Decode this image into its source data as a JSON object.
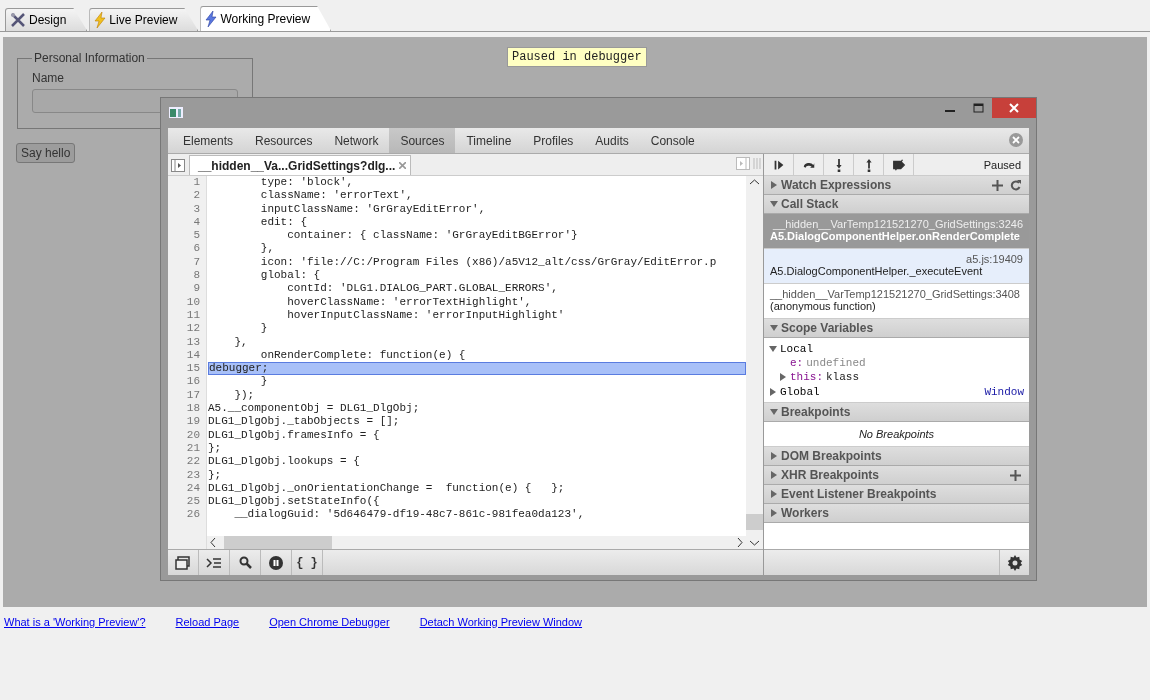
{
  "app_tabs": [
    {
      "kind": "design",
      "label": "Design",
      "selected": false
    },
    {
      "kind": "live",
      "label": "Live Preview",
      "selected": false
    },
    {
      "kind": "working",
      "label": "Working Preview",
      "selected": true
    }
  ],
  "preview": {
    "paused_label": "Paused in debugger",
    "fieldset_legend": "Personal Information",
    "name_label": "Name",
    "button": "Say hello"
  },
  "devtools": {
    "tabs": [
      {
        "label": "Elements",
        "selected": false
      },
      {
        "label": "Resources",
        "selected": false
      },
      {
        "label": "Network",
        "selected": false
      },
      {
        "label": "Sources",
        "selected": true
      },
      {
        "label": "Timeline",
        "selected": false
      },
      {
        "label": "Profiles",
        "selected": false
      },
      {
        "label": "Audits",
        "selected": false
      },
      {
        "label": "Console",
        "selected": false
      }
    ],
    "file_tab": "__hidden__Va...GridSettings?dlg...",
    "code_lines": [
      {
        "num": "1",
        "code": "        type: 'block',"
      },
      {
        "num": "2",
        "code": "        className: 'errorText',"
      },
      {
        "num": "3",
        "code": "        inputClassName: 'GrGrayEditError',"
      },
      {
        "num": "4",
        "code": "        edit: {"
      },
      {
        "num": "5",
        "code": "            container: { className: 'GrGrayEditBGError'}"
      },
      {
        "num": "6",
        "code": "        },"
      },
      {
        "num": "7",
        "code": "        icon: 'file://C:/Program Files (x86)/a5V12_alt/css/GrGray/EditError.p"
      },
      {
        "num": "8",
        "code": "        global: {"
      },
      {
        "num": "9",
        "code": "            contId: 'DLG1.DIALOG_PART.GLOBAL_ERRORS',"
      },
      {
        "num": "10",
        "code": "            hoverClassName: 'errorTextHighlight',"
      },
      {
        "num": "11",
        "code": "            hoverInputClassName: 'errorInputHighlight'"
      },
      {
        "num": "12",
        "code": "        }"
      },
      {
        "num": "13",
        "code": "    },"
      },
      {
        "num": "14",
        "code": "        onRenderComplete: function(e) {"
      },
      {
        "num": "15",
        "code": "debugger;",
        "selected": true
      },
      {
        "num": "16",
        "code": "        }"
      },
      {
        "num": "17",
        "code": "    });"
      },
      {
        "num": "18",
        "code": "A5.__componentObj = DLG1_DlgObj;"
      },
      {
        "num": "19",
        "code": "DLG1_DlgObj._tabObjects = [];"
      },
      {
        "num": "20",
        "code": "DLG1_DlgObj.framesInfo = {"
      },
      {
        "num": "21",
        "code": "};"
      },
      {
        "num": "22",
        "code": "DLG1_DlgObj.lookups = {"
      },
      {
        "num": "23",
        "code": "};"
      },
      {
        "num": "24",
        "code": "DLG1_DlgObj._onOrientationChange =  function(e) {   };"
      },
      {
        "num": "25",
        "code": "DLG1_DlgObj.setStateInfo({"
      },
      {
        "num": "26",
        "code": "    __dialogGuid: '5d646479-df19-48c7-861c-981fea0da123',"
      }
    ],
    "debugger_status": "Paused",
    "panes": [
      {
        "kind": "watch",
        "title": "Watch Expressions",
        "expanded": false
      },
      {
        "kind": "call_stack",
        "title": "Call Stack",
        "expanded": true,
        "frames": [
          {
            "location": "__hidden__VarTemp121521270_GridSettings:3246",
            "function": "A5.DialogComponentHelper.onRenderComplete",
            "selected": true,
            "hovered": false
          },
          {
            "location": "a5.js:19409",
            "function": "A5.DialogComponentHelper._executeEvent",
            "selected": false,
            "hovered": true
          },
          {
            "location": "__hidden__VarTemp121521270_GridSettings:3408",
            "function": "(anonymous function)",
            "selected": false,
            "hovered": false
          }
        ]
      },
      {
        "kind": "scope",
        "title": "Scope Variables",
        "expanded": true,
        "scopes": [
          {
            "name": "Local",
            "expanded": true,
            "vars": [
              {
                "name": "e:",
                "value": "undefined",
                "expandable": false
              },
              {
                "name": "this:",
                "value": "klass",
                "expandable": true
              }
            ]
          },
          {
            "name": "Global",
            "expanded": false,
            "value": "Window"
          }
        ]
      },
      {
        "kind": "breakpoints",
        "title": "Breakpoints",
        "expanded": true,
        "empty_text": "No Breakpoints"
      },
      {
        "kind": "dom",
        "title": "DOM Breakpoints",
        "expanded": false
      },
      {
        "kind": "xhr",
        "title": "XHR Breakpoints",
        "expanded": false
      },
      {
        "kind": "events",
        "title": "Event Listener Breakpoints",
        "expanded": false
      },
      {
        "kind": "workers",
        "title": "Workers",
        "expanded": false
      }
    ],
    "pretty_print_label": "{ }"
  },
  "links": [
    "What is a 'Working Preview'?",
    "Reload Page",
    "Open Chrome Debugger",
    "Detach Working Preview Window"
  ]
}
